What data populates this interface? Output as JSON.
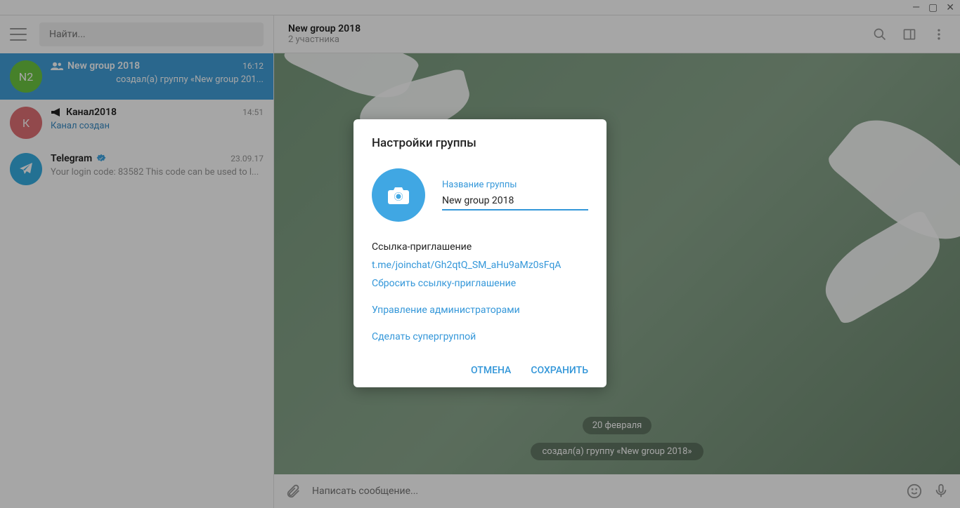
{
  "window": {
    "minimize": "—",
    "maximize": "▢",
    "close": "✕"
  },
  "sidebar": {
    "search_placeholder": "Найти...",
    "chats": [
      {
        "avatar_text": "N2",
        "avatar_color": "#6cc641",
        "title": "New group 2018",
        "time": "16:12",
        "preview": "создал(а) группу «New group 201...",
        "icon": "group"
      },
      {
        "avatar_text": "К",
        "avatar_color": "#e17076",
        "title": "Канал2018",
        "time": "14:51",
        "preview": "Канал создан",
        "icon": "megaphone"
      },
      {
        "avatar_text": "",
        "avatar_color": "#37aee2",
        "title": "Telegram",
        "time": "23.09.17",
        "preview": "Your login code: 83582  This code can be used to l...",
        "icon": "verified"
      }
    ]
  },
  "header": {
    "title": "New group 2018",
    "subtitle": "2 участника"
  },
  "chat": {
    "date": "20 февраля",
    "system": "создал(а) группу «New group 2018»"
  },
  "compose": {
    "placeholder": "Написать сообщение..."
  },
  "dialog": {
    "title": "Настройки группы",
    "name_label": "Название группы",
    "name_value": "New group 2018",
    "invite_section": "Ссылка-приглашение",
    "invite_link": "t.me/joinchat/Gh2qtQ_SM_aHu9aMz0sFqA",
    "reset_link": "Сбросить ссылку-приглашение",
    "manage_admins": "Управление администраторами",
    "make_supergroup": "Сделать супергруппой",
    "cancel": "ОТМЕНА",
    "save": "СОХРАНИТЬ"
  }
}
